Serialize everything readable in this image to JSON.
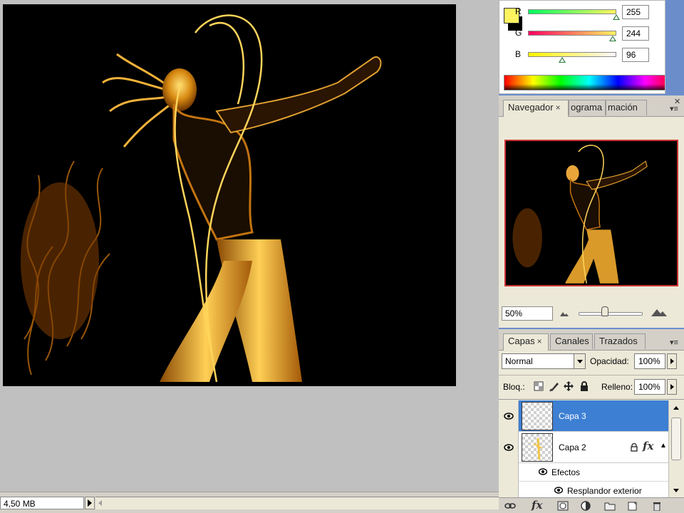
{
  "status_bar": {
    "doc_size": "4,50 MB"
  },
  "color_panel": {
    "foreground": "#fff460",
    "background": "#000000",
    "channels": [
      {
        "label": "R",
        "value": "255",
        "fraction": 1.0,
        "gradient": [
          "#00ff60",
          "#fff460"
        ]
      },
      {
        "label": "G",
        "value": "244",
        "fraction": 0.957,
        "gradient": [
          "#ff0060",
          "#fff460"
        ]
      },
      {
        "label": "B",
        "value": "96",
        "fraction": 0.376,
        "gradient": [
          "#fff400",
          "#fff4ff"
        ]
      }
    ]
  },
  "navigator_panel": {
    "tabs": [
      {
        "label": "Navegador",
        "active": true,
        "close": "×"
      },
      {
        "label": "ograma",
        "active": false
      },
      {
        "label": "mación",
        "active": false
      }
    ],
    "zoom": "50%",
    "zoom_fraction": 0.4
  },
  "layers_panel": {
    "tabs": [
      {
        "label": "Capas",
        "active": true,
        "close": "×"
      },
      {
        "label": "Canales",
        "active": false
      },
      {
        "label": "Trazados",
        "active": false
      }
    ],
    "blend_mode": "Normal",
    "opacity_label": "Opacidad:",
    "opacity": "100%",
    "lock_label": "Bloq.:",
    "fill_label": "Relleno:",
    "fill": "100%",
    "layers": [
      {
        "name": "Capa 3",
        "selected": true
      },
      {
        "name": "Capa 2",
        "selected": false,
        "fx": "fx"
      }
    ],
    "effects_label": "Efectos",
    "effect_name": "Resplandor exterior",
    "footer_fx": "fx"
  }
}
